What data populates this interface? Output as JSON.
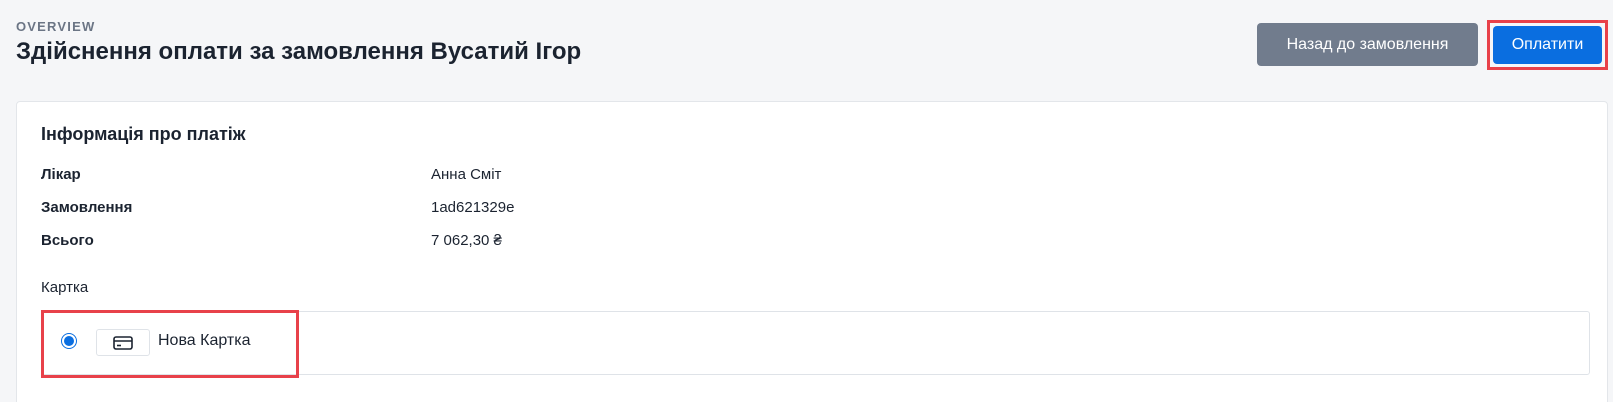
{
  "header": {
    "eyebrow": "OVERVIEW",
    "title": "Здійснення оплати за замовлення Вусатий Ігор",
    "back_button_label": "Назад до замовлення",
    "pay_button_label": "Оплатити"
  },
  "payment_info": {
    "section_title": "Інформація про платіж",
    "rows": [
      {
        "label": "Лікар",
        "value": "Анна Сміт"
      },
      {
        "label": "Замовлення",
        "value": "1ad621329e"
      },
      {
        "label": "Всього",
        "value": "7 062,30 ₴"
      }
    ],
    "card_label": "Картка",
    "card_options": [
      {
        "label": "Нова Картка",
        "selected": true,
        "icon": "credit-card-icon"
      }
    ]
  },
  "colors": {
    "primary": "#0a6ee0",
    "secondary": "#717c8d",
    "highlight": "#e8414a"
  }
}
